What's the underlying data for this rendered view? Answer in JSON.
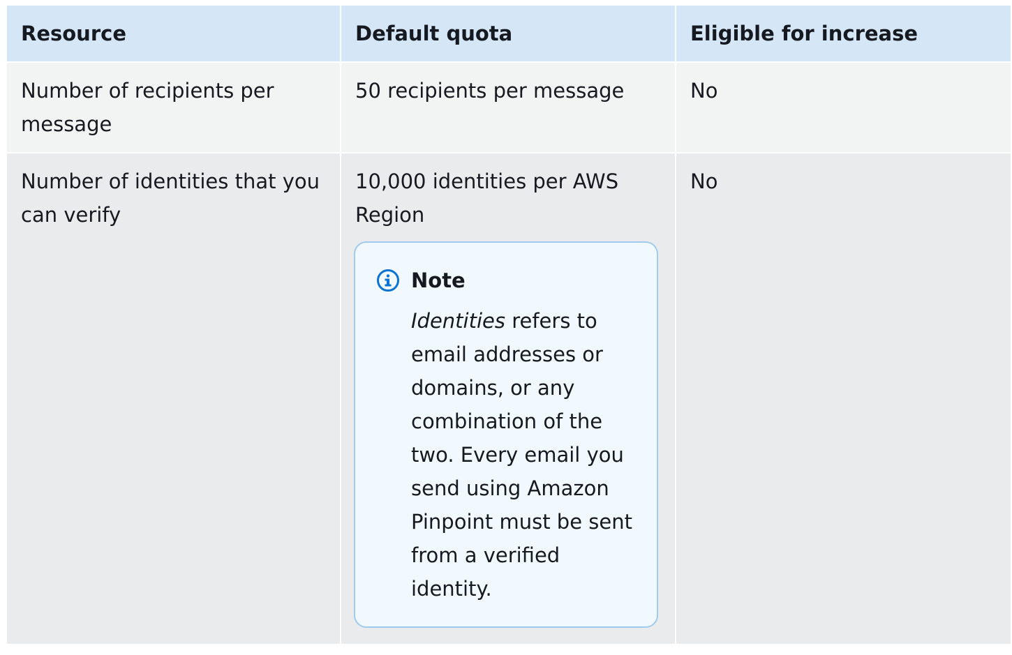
{
  "table": {
    "headers": [
      "Resource",
      "Default quota",
      "Eligible for increase"
    ],
    "rows": [
      {
        "resource": "Number of recipients per message",
        "quota": "50 recipients per message",
        "eligible": "No"
      },
      {
        "resource": "Number of identities that you can verify",
        "quota": "10,000 identities per AWS Region",
        "eligible": "No",
        "note": {
          "icon": "info-icon",
          "title": "Note",
          "term": "Identities",
          "text": " refers to email addresses or domains, or any combination of the two. Every email you send using Amazon Pinpoint must be sent from a verified identity."
        }
      }
    ]
  },
  "colors": {
    "header_bg": "#d5e6f7",
    "row_bg_1": "#f2f3f3",
    "row_bg_2": "#e9ebed",
    "note_bg": "#f1f8fe",
    "note_border": "#9fcbf0",
    "info_icon": "#0972d3"
  }
}
